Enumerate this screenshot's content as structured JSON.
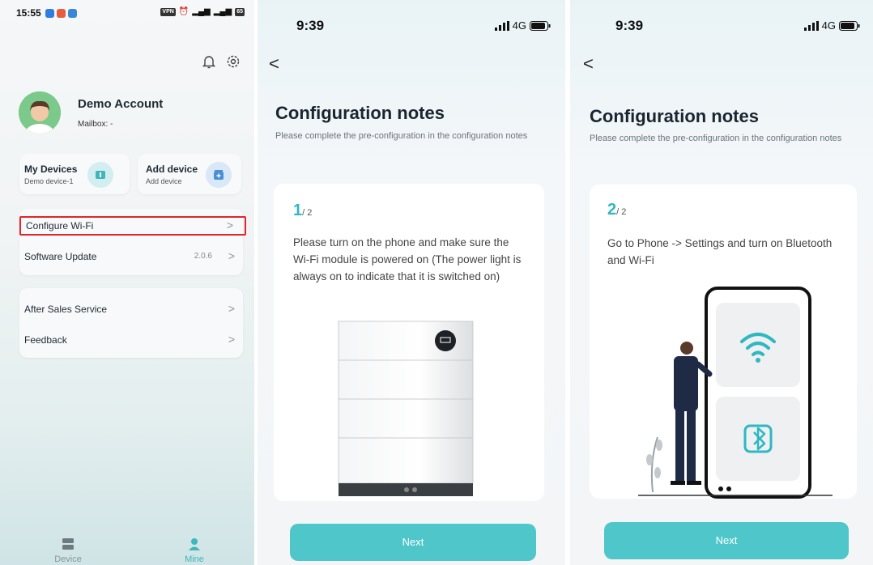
{
  "screen1": {
    "status_bar": {
      "time": "15:55",
      "vpn": "VPN",
      "battery": "65"
    },
    "account": {
      "name": "Demo Account",
      "mailbox": "Mailbox: -"
    },
    "cards": {
      "my_devices": {
        "title": "My Devices",
        "subtitle": "Demo device-1"
      },
      "add_device": {
        "title": "Add device",
        "subtitle": "Add device"
      }
    },
    "menu": {
      "configure_wifi": "Configure Wi-Fi",
      "software_update": "Software Update",
      "software_version": "2.0.6",
      "after_sales": "After Sales Service",
      "feedback": "Feedback"
    },
    "tabbar": {
      "device": "Device",
      "mine": "Mine"
    }
  },
  "screen2": {
    "status_bar": {
      "time": "9:39",
      "network": "4G"
    },
    "title": "Configuration notes",
    "subtitle": "Please complete the pre-configuration in the configuration notes",
    "step_current": "1",
    "step_total": "/ 2",
    "description": "Please turn on the phone and make sure the Wi-Fi module is powered on (The power light is always on to indicate that it is switched on)",
    "next_button": "Next"
  },
  "screen3": {
    "status_bar": {
      "time": "9:39",
      "network": "4G"
    },
    "title": "Configuration notes",
    "subtitle": "Please complete the pre-configuration in the configuration notes",
    "step_current": "2",
    "step_total": "/ 2",
    "description": "Go to Phone -> Settings and turn on Bluetooth and Wi-Fi",
    "next_button": "Next"
  },
  "colors": {
    "accent": "#4fc7ca",
    "step": "#2fb7c2",
    "highlight_border": "#e1252b"
  },
  "icons": [
    "bell-icon",
    "gear-icon",
    "chevron-right-icon",
    "back-arrow-icon",
    "wifi-icon",
    "bluetooth-icon",
    "device-tab-icon",
    "mine-tab-icon"
  ]
}
